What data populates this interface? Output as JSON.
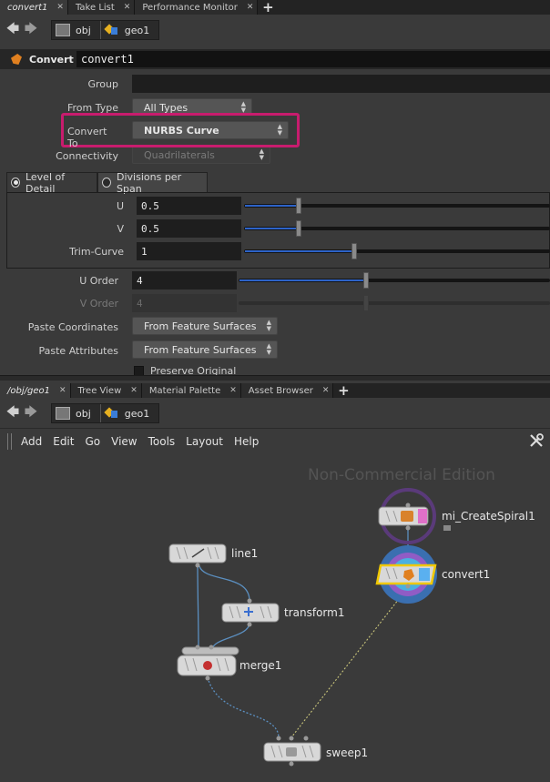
{
  "top_tabs": [
    {
      "label": "convert1",
      "active": true
    },
    {
      "label": "Take List",
      "active": false
    },
    {
      "label": "Performance Monitor",
      "active": false
    }
  ],
  "bottom_tabs": [
    {
      "label": "/obj/geo1",
      "active": true
    },
    {
      "label": "Tree View",
      "active": false
    },
    {
      "label": "Material Palette",
      "active": false
    },
    {
      "label": "Asset Browser",
      "active": false
    }
  ],
  "path": {
    "obj": "obj",
    "geo": "geo1"
  },
  "node_header": {
    "type": "Convert",
    "name": "convert1"
  },
  "params": {
    "group": {
      "label": "Group",
      "value": ""
    },
    "from_type": {
      "label": "From Type",
      "value": "All Types"
    },
    "convert_to": {
      "label": "Convert To",
      "value": "NURBS Curve"
    },
    "connectivity": {
      "label": "Connectivity",
      "value": "Quadrilaterals"
    },
    "lod_tab": "Level of Detail",
    "divisions_tab": "Divisions per Span",
    "u": {
      "label": "U",
      "value": "0.5",
      "fraction": 0.18
    },
    "v": {
      "label": "V",
      "value": "0.5",
      "fraction": 0.18
    },
    "trim_curve": {
      "label": "Trim-Curve",
      "value": "1",
      "fraction": 0.36
    },
    "u_order": {
      "label": "U Order",
      "value": "4",
      "fraction": 0.41
    },
    "v_order": {
      "label": "V Order",
      "value": "4",
      "fraction": 0.41
    },
    "paste_coordinates": {
      "label": "Paste Coordinates",
      "value": "From Feature Surfaces"
    },
    "paste_attributes": {
      "label": "Paste Attributes",
      "value": "From Feature Surfaces"
    },
    "preserve_original": {
      "label": "Preserve Original"
    }
  },
  "network_menu": [
    "Add",
    "Edit",
    "Go",
    "View",
    "Tools",
    "Layout",
    "Help"
  ],
  "watermark": "Non-Commercial Edition",
  "nodes": {
    "spiral": "mi_CreateSpiral1",
    "convert": "convert1",
    "line": "line1",
    "transform": "transform1",
    "merge": "merge1",
    "sweep": "sweep1"
  },
  "colors": {
    "highlight": "#c81c6e",
    "slider_fill": "#2d63c8",
    "display_flag": "#5a3a7a",
    "selected_outline": "#f0c800"
  }
}
